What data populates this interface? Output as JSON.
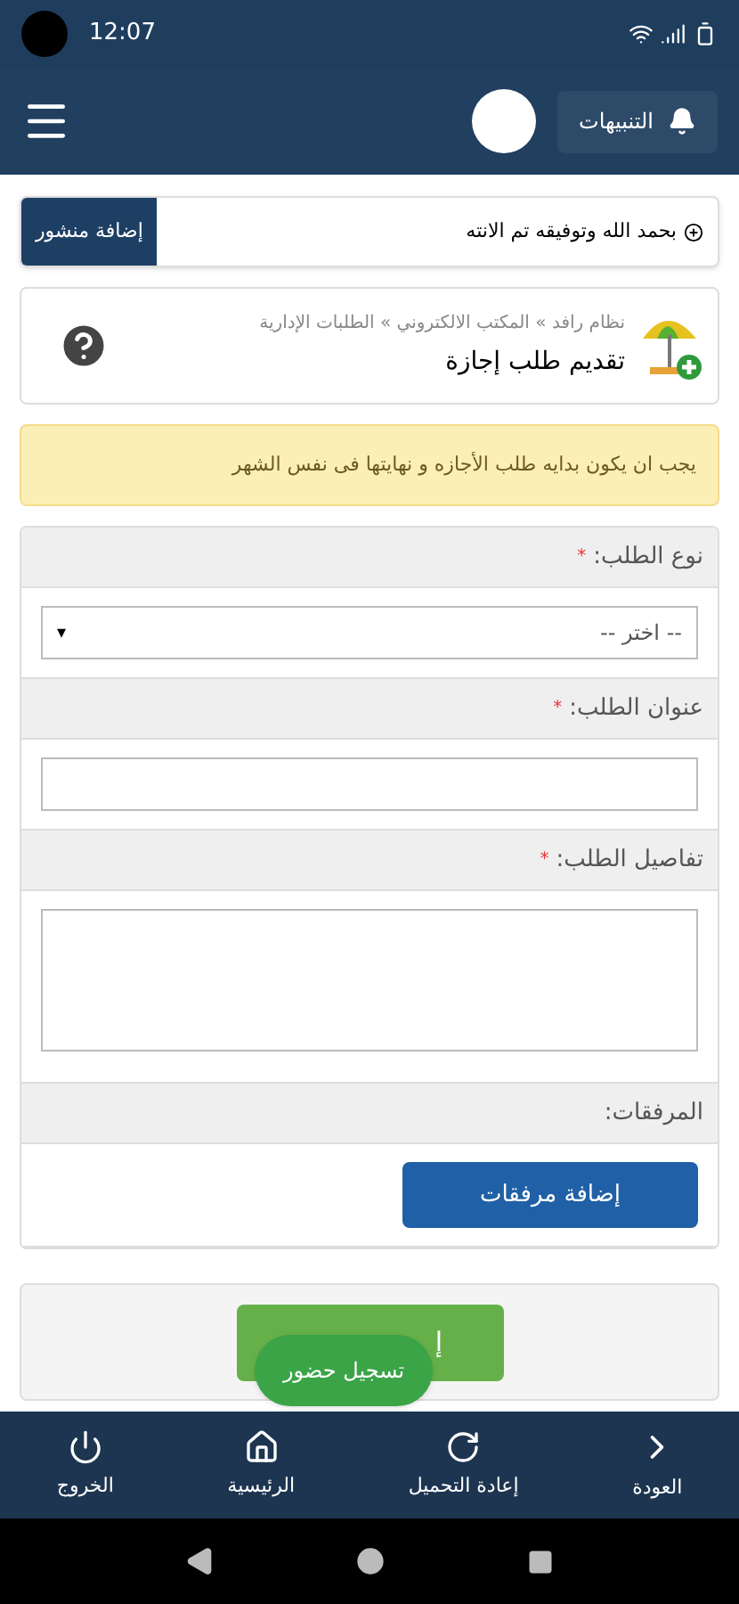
{
  "status_bar": {
    "time": "12:07"
  },
  "header": {
    "notifications": "التنبيهات"
  },
  "ticker": {
    "text": "بحمد الله وتوفيقه تم الانته",
    "button": "إضافة منشور"
  },
  "breadcrumb": {
    "items": [
      "نظام رافد",
      "المكتب الالكتروني",
      "الطلبات الإدارية"
    ],
    "separator": "»",
    "title": "تقديم طلب إجازة"
  },
  "alert": "يجب ان يكون بدايه طلب الأجازه و نهايتها فى نفس الشهر",
  "form": {
    "fields": [
      {
        "kind": "select",
        "label": "نوع الطلب:",
        "required_mark": "*",
        "value": "-- اختر --",
        "arrow": "▾"
      },
      {
        "kind": "text",
        "label": "عنوان الطلب:",
        "required_mark": "*"
      },
      {
        "kind": "textarea",
        "label": "تفاصيل الطلب:",
        "required_mark": "*"
      },
      {
        "kind": "attachments",
        "label": "المرفقات:",
        "button": "إضافة مرفقات"
      }
    ]
  },
  "submit": {
    "label": "إ"
  },
  "floating_button": "تسجيل حضور",
  "bottom_nav": [
    {
      "kind": "back",
      "label": "العودة"
    },
    {
      "kind": "reload",
      "label": "إعادة التحميل"
    },
    {
      "kind": "home",
      "label": "الرئيسية"
    },
    {
      "kind": "logout",
      "label": "الخروج"
    }
  ]
}
